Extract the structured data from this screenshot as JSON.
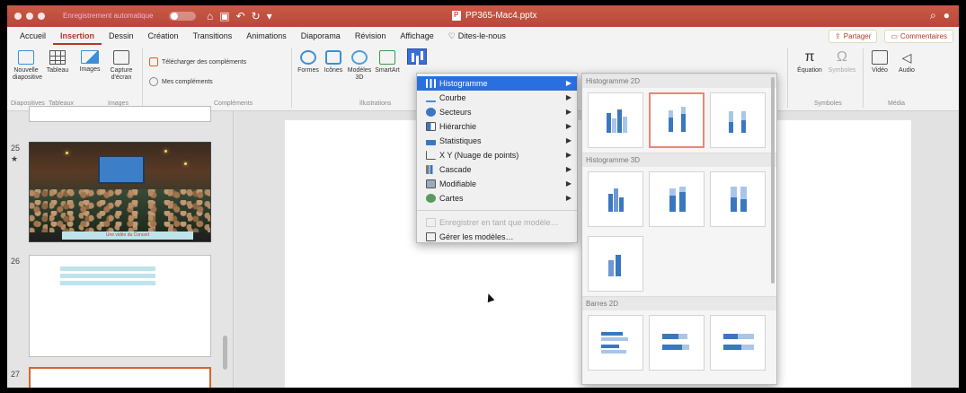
{
  "titlebar": {
    "autosave_label": "Enregistrement automatique",
    "toggle_state": "OFF",
    "document_title": "PP365-Mac4.pptx"
  },
  "tabs": [
    {
      "label": "Accueil"
    },
    {
      "label": "Insertion"
    },
    {
      "label": "Dessin"
    },
    {
      "label": "Création"
    },
    {
      "label": "Transitions"
    },
    {
      "label": "Animations"
    },
    {
      "label": "Diaporama"
    },
    {
      "label": "Révision"
    },
    {
      "label": "Affichage"
    },
    {
      "label": "Dites-le-nous"
    }
  ],
  "tabs_right": {
    "share": "Partager",
    "comments": "Commentaires"
  },
  "ribbon": {
    "new_slide": "Nouvelle diapositive",
    "table": "Tableau",
    "images": "Images",
    "screenshot": "Capture d'écran",
    "get_addins": "Télécharger des compléments",
    "my_addins": "Mes compléments",
    "shapes": "Formes",
    "icons": "Icônes",
    "models3d": "Modèles 3D",
    "smartart": "SmartArt",
    "equation": "Équation",
    "symbols": "Symboles",
    "video": "Vidéo",
    "audio": "Audio",
    "group_slides": "Diapositives",
    "group_tables": "Tableaux",
    "group_images": "Images",
    "group_addins": "Compléments",
    "group_illustrations": "Illustrations",
    "group_symbols": "Symboles",
    "group_media": "Média"
  },
  "slides": {
    "n25": "25",
    "n26": "26",
    "n27": "27",
    "caption25": "Une vidéo du Concert"
  },
  "chart_menu": {
    "items": [
      {
        "label": "Histogramme",
        "icon": "column-chart-icon"
      },
      {
        "label": "Courbe",
        "icon": "line-chart-icon"
      },
      {
        "label": "Secteurs",
        "icon": "pie-chart-icon"
      },
      {
        "label": "Hiérarchie",
        "icon": "hierarchy-chart-icon"
      },
      {
        "label": "Statistiques",
        "icon": "statistics-chart-icon"
      },
      {
        "label": "X Y (Nuage de points)",
        "icon": "scatter-chart-icon"
      },
      {
        "label": "Cascade",
        "icon": "waterfall-chart-icon"
      },
      {
        "label": "Modifiable",
        "icon": "stock-chart-icon"
      },
      {
        "label": "Cartes",
        "icon": "map-chart-icon"
      }
    ],
    "save_template": "Enregistrer en tant que modèle…",
    "manage_templates": "Gérer les modèles…"
  },
  "gallery": {
    "section_2d": "Histogramme 2D",
    "section_3d": "Histogramme 3D",
    "section_bars": "Barres 2D"
  },
  "colors": {
    "accent": "#b23a28",
    "selection": "#2a6fe0",
    "chart_blue": "#3b77c0"
  }
}
